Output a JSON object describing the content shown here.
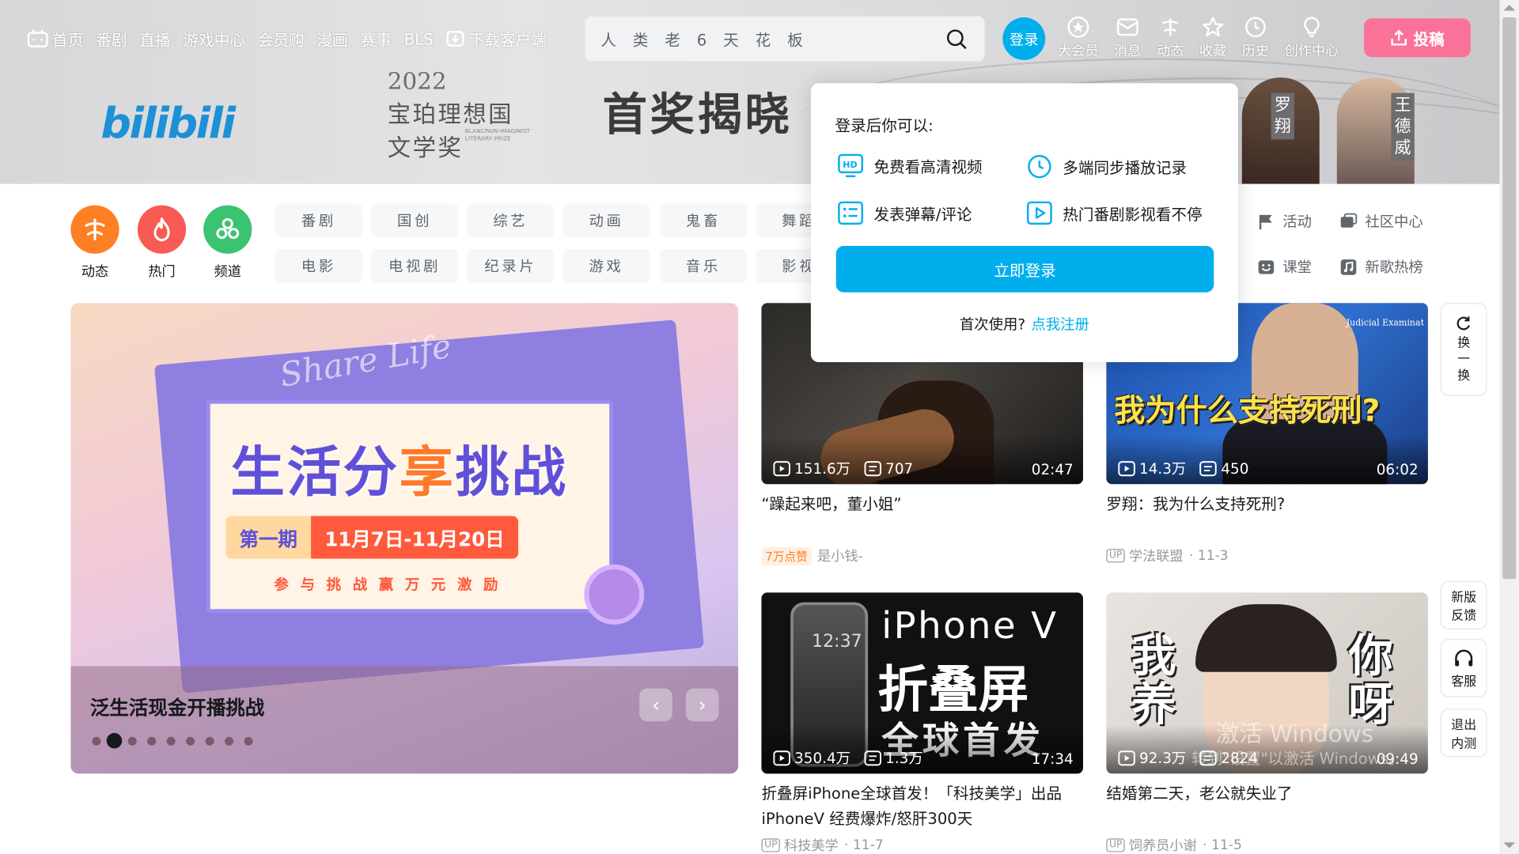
{
  "nav": {
    "items": [
      "首页",
      "番剧",
      "直播",
      "游戏中心",
      "会员购",
      "漫画",
      "赛事",
      "BLS",
      "下载客户端"
    ]
  },
  "search": {
    "placeholder": "人 类 老 6 天 花 板"
  },
  "header": {
    "login_label": "登录",
    "icons": [
      {
        "label": "大会员",
        "icon": "vip-icon"
      },
      {
        "label": "消息",
        "icon": "message-icon"
      },
      {
        "label": "动态",
        "icon": "dynamic-icon"
      },
      {
        "label": "收藏",
        "icon": "star-icon"
      },
      {
        "label": "历史",
        "icon": "clock-icon"
      },
      {
        "label": "创作中心",
        "icon": "bulb-icon"
      }
    ],
    "upload_label": "投稿"
  },
  "banner": {
    "logo": "bilibili",
    "year": "2022",
    "line1": "宝珀理想国",
    "line2": "文学奖",
    "english": "BLANCPAIN-IMAGINIST LITERARY PRIZE",
    "headline": "首奖揭晓",
    "tag1": "罗翔",
    "tag2": "王德威"
  },
  "channels": [
    {
      "label": "动态",
      "color": "#ff7f24"
    },
    {
      "label": "热门",
      "color": "#f85a54"
    },
    {
      "label": "频道",
      "color": "#3ac370"
    }
  ],
  "categories": {
    "row1": [
      "番剧",
      "国创",
      "综艺",
      "动画",
      "鬼畜",
      "舞蹈"
    ],
    "row2": [
      "电影",
      "电视剧",
      "纪录片",
      "游戏",
      "音乐",
      "影视"
    ]
  },
  "right_links": {
    "row1": [
      "活动",
      "社区中心"
    ],
    "row2": [
      "课堂",
      "新歌热榜"
    ]
  },
  "carousel": {
    "title_a": "生活分",
    "title_b": "享",
    "title_c": "挑",
    "title_d": "战",
    "period_a": "第一期",
    "period_b": "11月7日-11月20日",
    "sub": "参与挑战赢万元激励",
    "handwriting": "Share Life",
    "caption": "泛生活现金开播挑战",
    "dot_count": 9,
    "active_dot": 2,
    "prev": "‹",
    "next": "›"
  },
  "videos": [
    {
      "views": "151.6万",
      "danmaku": "707",
      "duration": "02:47",
      "title": "“躁起来吧，董小姐”",
      "badge": "7万点赞",
      "author": "是小钱-",
      "date": ""
    },
    {
      "views": "14.3万",
      "danmaku": "450",
      "duration": "06:02",
      "title": "罗翔：我为什么支持死刑?",
      "badge": "",
      "author": "学法联盟",
      "date": "· 11-3",
      "overlay": "我为什么支持死刑?",
      "overlay_small": "Judicial Examinat"
    },
    {
      "views": "350.4万",
      "danmaku": "1.3万",
      "duration": "17:34",
      "title": "折叠屏iPhone全球首发！「科技美学」出品 iPhoneV 经费爆炸/怒肝300天",
      "badge": "",
      "author": "科技美学",
      "date": "· 11-7",
      "overlay1": "iPhone V",
      "overlay2": "折叠屏",
      "overlay3": "全球首发",
      "screen_time": "12:37"
    },
    {
      "views": "92.3万",
      "danmaku": "2824",
      "duration": "09:49",
      "title": "结婚第二天，老公就失业了",
      "badge": "",
      "author": "饲养员小谢",
      "date": "· 11-5",
      "overlay_left": "我养",
      "overlay_right": "你呀"
    }
  ],
  "floating": {
    "refresh": "换一换",
    "feedback1": "新版",
    "feedback2": "反馈",
    "service": "客服",
    "exit1": "退出",
    "exit2": "内测"
  },
  "popup": {
    "title": "登录后你可以:",
    "features": [
      "免费看高清视频",
      "多端同步播放记录",
      "发表弹幕/评论",
      "热门番剧影视看不停"
    ],
    "button": "立即登录",
    "first_use": "首次使用?",
    "register": "点我注册"
  },
  "watermark": {
    "line1": "激活 Windows",
    "line2": "转到\"设置\"以激活 Windows。"
  },
  "colors": {
    "accent": "#00aeec",
    "pink": "#fb7299",
    "text": "#18191c",
    "muted": "#9499a0"
  }
}
